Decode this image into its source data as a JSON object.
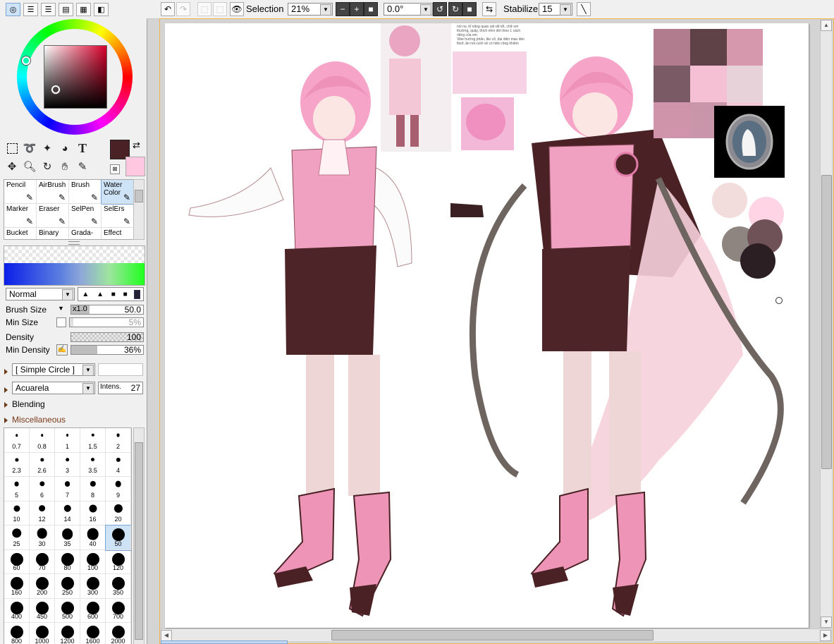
{
  "left_panel": {
    "tool_groups": [
      {
        "name": "selection-tools",
        "icons": [
          "rect-select-icon",
          "lasso-icon",
          "magic-wand-icon",
          "fill-select-icon",
          "text-icon"
        ]
      },
      {
        "name": "view-tools",
        "icons": [
          "move-icon",
          "zoom-icon",
          "rotate-icon",
          "hand-icon",
          "eyedropper-icon"
        ]
      }
    ],
    "text_tool_glyph": "T",
    "colors": {
      "foreground": "#4a2226",
      "background": "#ffc8e0"
    },
    "brushes": [
      {
        "label": "Pencil",
        "icon": "pencil-icon"
      },
      {
        "label": "AirBrush",
        "icon": "airbrush-icon"
      },
      {
        "label": "Brush",
        "icon": "brush-icon"
      },
      {
        "label": "Water Color",
        "icon": "watercolor-icon",
        "selected": true
      },
      {
        "label": "Marker",
        "icon": "marker-icon"
      },
      {
        "label": "Eraser",
        "icon": "eraser-icon"
      },
      {
        "label": "SelPen",
        "icon": "selpen-icon"
      },
      {
        "label": "SelErs",
        "icon": "selers-icon"
      },
      {
        "label": "Bucket",
        "icon": "bucket-icon"
      },
      {
        "label": "Binary",
        "icon": "binary-icon"
      },
      {
        "label": "Grada-",
        "icon": "gradation-icon"
      },
      {
        "label": "Effect",
        "icon": "effect-icon"
      }
    ],
    "blend_mode": "Normal",
    "brush_size": {
      "label": "Brush Size",
      "multiplier": "x1.0",
      "value": "50.0",
      "fill_fraction": 0.25
    },
    "min_size": {
      "label": "Min Size",
      "value": "5%",
      "fill_fraction": 0.05
    },
    "density": {
      "label": "Density",
      "value": "100",
      "fill_fraction": 1.0
    },
    "min_density": {
      "label": "Min Density",
      "value": "36%",
      "fill_fraction": 0.36
    },
    "shape": "[ Simple Circle ]",
    "texture": "Acuarela",
    "intensity": {
      "label": "Intens.",
      "value": "27"
    },
    "sections": [
      "Blending",
      "Miscellaneous"
    ],
    "sizes": [
      "0.7",
      "0.8",
      "1",
      "1.5",
      "2",
      "2.3",
      "2.6",
      "3",
      "3.5",
      "4",
      "5",
      "6",
      "7",
      "8",
      "9",
      "10",
      "12",
      "14",
      "16",
      "20",
      "25",
      "30",
      "35",
      "40",
      "50",
      "60",
      "70",
      "80",
      "100",
      "120",
      "160",
      "200",
      "250",
      "300",
      "350",
      "400",
      "450",
      "500",
      "600",
      "700",
      "800",
      "1000",
      "1200",
      "1600",
      "2000"
    ],
    "selected_size": "50"
  },
  "toolbar": {
    "selection_label": "Selection",
    "zoom": "21%",
    "rotation": "0.0°",
    "stabilizer_label": "Stabilizer",
    "stabilizer": "15"
  },
  "canvas": {
    "ref_note_lines": [
      "nói nọ, kĩ năng quan sát rất tốt, chữ sơi",
      "thường, quậy, thích nhìn đời theo 1 cách",
      "riêng của em",
      "Vibe hướng phấn, lão cổ, đại diện màu đen",
      "floof, ăn nói cười về có hiện rộng khiêm"
    ],
    "palette": [
      "#f2dcdc",
      "#ffd4e4",
      "#8f8580",
      "#6e5258",
      "#2c1f24"
    ],
    "ink": "#4a2226"
  }
}
